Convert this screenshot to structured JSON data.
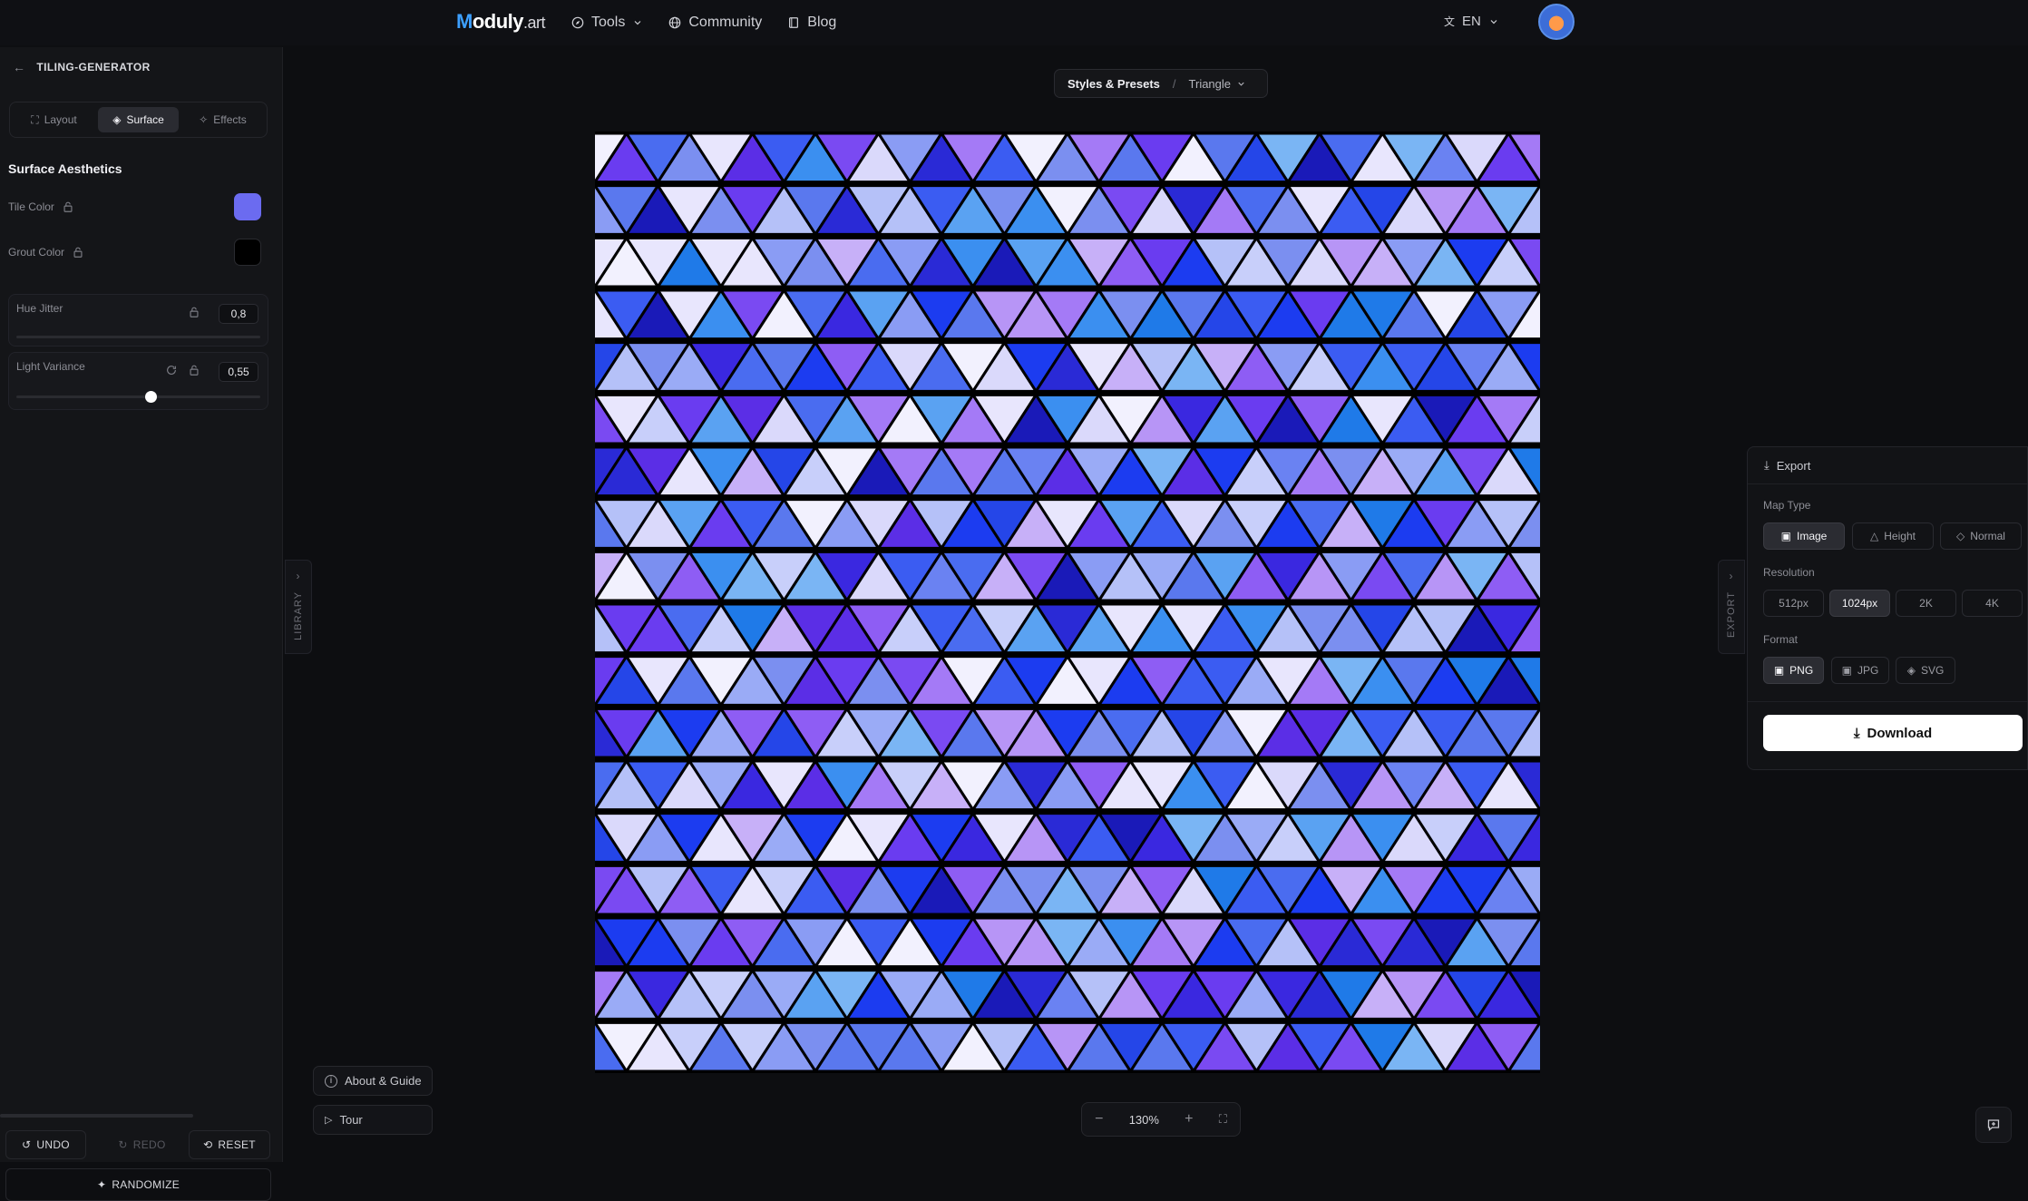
{
  "header": {
    "logo_text_a": "M",
    "logo_text_b": "oduly",
    "logo_text_c": ".art",
    "nav": [
      {
        "label": "Tools",
        "icon": "compass-icon"
      },
      {
        "label": "Community",
        "icon": "globe-icon"
      },
      {
        "label": "Blog",
        "icon": "book-icon"
      }
    ],
    "language": "EN"
  },
  "sidebar": {
    "title": "TILING-GENERATOR",
    "tabs": [
      {
        "label": "Layout",
        "active": false
      },
      {
        "label": "Surface",
        "active": true
      },
      {
        "label": "Effects",
        "active": false
      }
    ],
    "section_title": "Surface Aesthetics",
    "tile_color_label": "Tile Color",
    "tile_color": "#6B6BF0",
    "grout_color_label": "Grout Color",
    "grout_color": "#000000",
    "hue_jitter": {
      "label": "Hue Jitter",
      "value": "0,8"
    },
    "light_variance": {
      "label": "Light Variance",
      "value": "0,55",
      "fraction": 0.55
    },
    "undo_label": "UNDO",
    "redo_label": "REDO",
    "reset_label": "RESET",
    "randomize_label": "RANDOMIZE"
  },
  "library_tab": "LIBRARY",
  "export_tab": "EXPORT",
  "breadcrumb": {
    "section": "Styles & Presets",
    "separator": "/",
    "preset": "Triangle"
  },
  "help": {
    "about_label": "About & Guide",
    "tour_label": "Tour"
  },
  "zoom": {
    "minus": "−",
    "level": "130%",
    "plus": "+"
  },
  "export_panel": {
    "title": "Export",
    "map_type_label": "Map Type",
    "map_types": [
      {
        "label": "Image",
        "selected": true
      },
      {
        "label": "Height",
        "selected": false
      },
      {
        "label": "Normal",
        "selected": false
      }
    ],
    "resolution_label": "Resolution",
    "resolutions": [
      {
        "label": "512px",
        "selected": false
      },
      {
        "label": "1024px",
        "selected": true
      },
      {
        "label": "2K",
        "selected": false
      },
      {
        "label": "4K",
        "selected": false
      }
    ],
    "format_label": "Format",
    "formats": [
      {
        "label": "PNG",
        "selected": true
      },
      {
        "label": "JPG",
        "selected": false
      },
      {
        "label": "SVG",
        "selected": false
      }
    ],
    "download_label": "Download"
  },
  "tiles": {
    "rows": 18,
    "triangles_per_row": 29,
    "grout_color": "#000000",
    "palette": [
      "#1c3cf0",
      "#2546e8",
      "#3b5cf2",
      "#4a6cf0",
      "#5a78ee",
      "#6a82f2",
      "#7b8ff0",
      "#8a9cf4",
      "#9aabf6",
      "#b5c1f8",
      "#c8cffa",
      "#dad9fb",
      "#e8e6fd",
      "#f2f1fe",
      "#5b2ee6",
      "#6a3cf0",
      "#7a4af2",
      "#8e5df4",
      "#a47af6",
      "#b795f6",
      "#c7b0f8",
      "#2a2ad6",
      "#3a28e0",
      "#1f7ae8",
      "#3b8ff0",
      "#5aa2f2",
      "#7ab5f4",
      "#1a1ab8"
    ]
  }
}
